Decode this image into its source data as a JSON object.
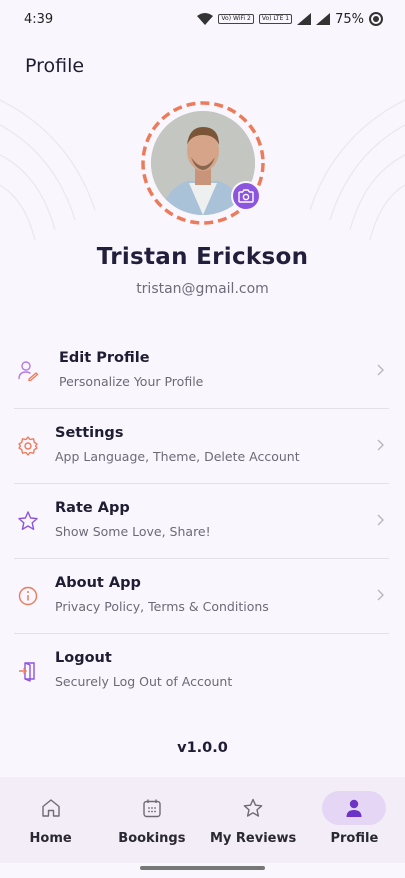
{
  "status_bar": {
    "time": "4:39",
    "badge_wifi": "Vo) WiFi 2",
    "badge_lte": "Vo) LTE 1",
    "battery": "75%"
  },
  "header": {
    "title": "Profile"
  },
  "profile": {
    "name": "Tristan Erickson",
    "email": "tristan@gmail.com"
  },
  "menu": {
    "items": [
      {
        "title": "Edit Profile",
        "subtitle": "Personalize Your Profile",
        "icon": "user-edit-icon",
        "color": "#b57be6"
      },
      {
        "title": "Settings",
        "subtitle": "App Language, Theme, Delete Account",
        "icon": "gear-icon",
        "color": "#ec7b5b"
      },
      {
        "title": "Rate App",
        "subtitle": "Show Some Love, Share!",
        "icon": "star-icon",
        "color": "#8c55df"
      },
      {
        "title": "About App",
        "subtitle": "Privacy Policy, Terms & Conditions",
        "icon": "info-icon",
        "color": "#ec7b5b"
      },
      {
        "title": "Logout",
        "subtitle": "Securely Log Out of Account",
        "icon": "logout-icon",
        "color": "#8c55df"
      }
    ]
  },
  "version": "v1.0.0",
  "bottom_nav": {
    "items": [
      {
        "label": "Home",
        "icon": "home-icon"
      },
      {
        "label": "Bookings",
        "icon": "calendar-icon"
      },
      {
        "label": "My Reviews",
        "icon": "star-icon"
      },
      {
        "label": "Profile",
        "icon": "person-icon",
        "active": true
      }
    ]
  },
  "colors": {
    "accent": "#8c55df",
    "ring": "#ec7b5b",
    "background": "#faf6fd"
  }
}
